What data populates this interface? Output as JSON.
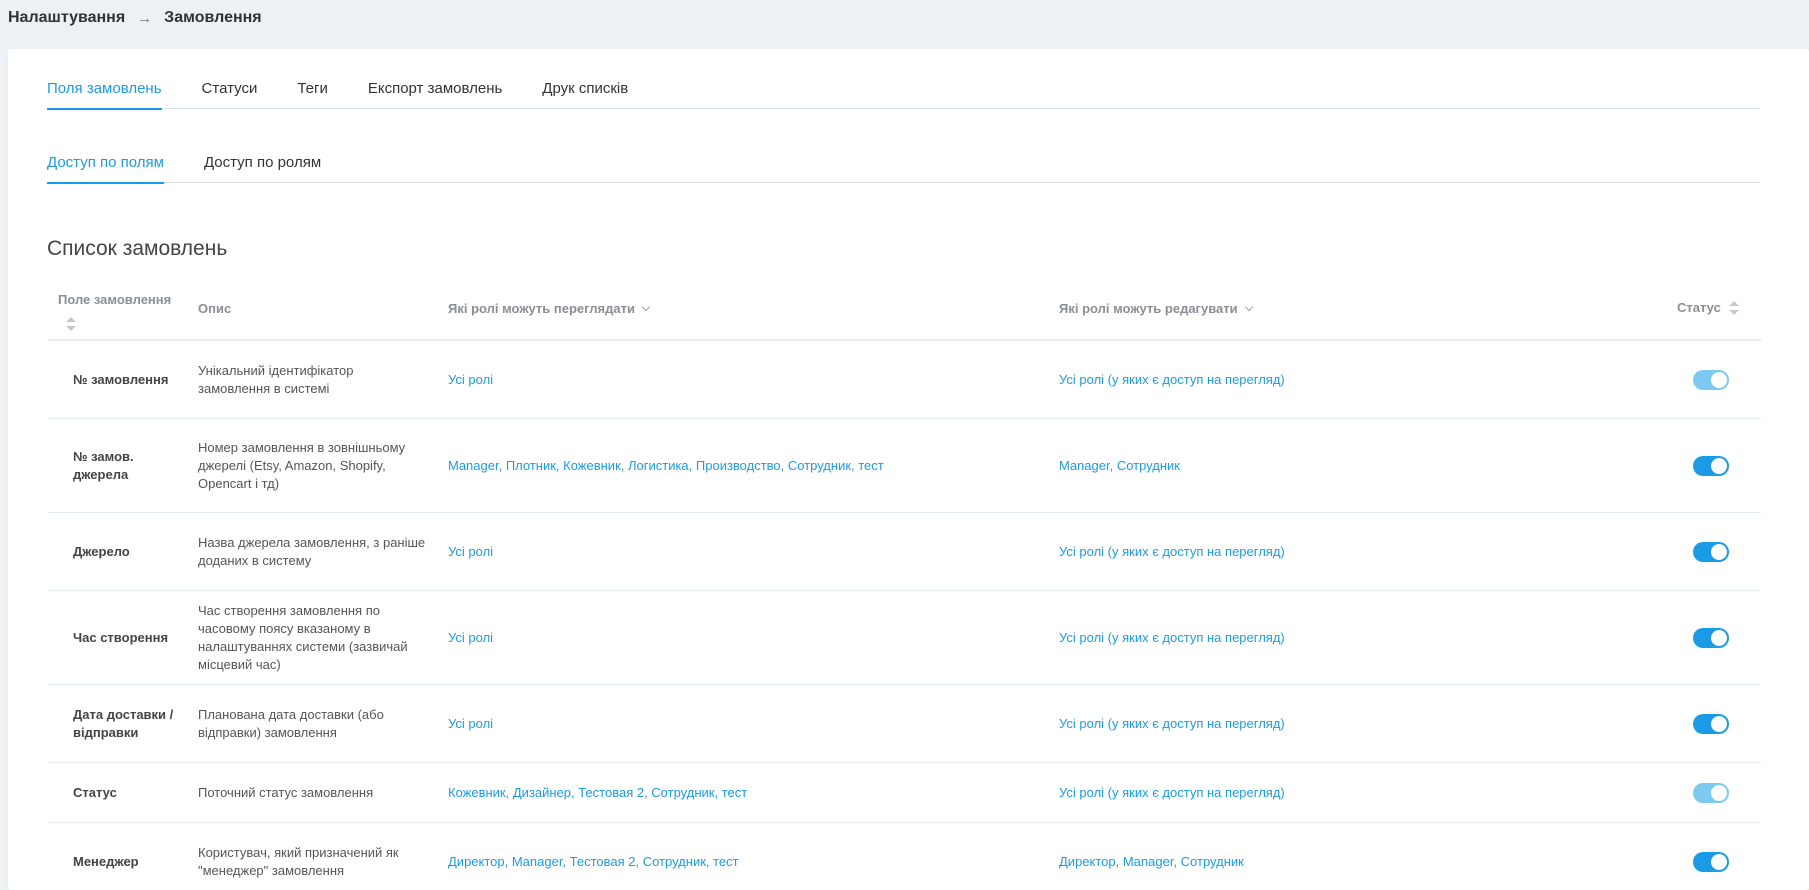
{
  "breadcrumb": {
    "parent": "Налаштування",
    "arrow": "→",
    "current": "Замовлення"
  },
  "tabs": [
    {
      "label": "Поля замовлень",
      "active": true
    },
    {
      "label": "Статуси",
      "active": false
    },
    {
      "label": "Теги",
      "active": false
    },
    {
      "label": "Експорт замовлень",
      "active": false
    },
    {
      "label": "Друк списків",
      "active": false
    }
  ],
  "subtabs": [
    {
      "label": "Доступ по полям",
      "active": true
    },
    {
      "label": "Доступ по ролям",
      "active": false
    }
  ],
  "section_title": "Список замовлень",
  "table": {
    "headers": {
      "field": "Поле замовлення",
      "description": "Опис",
      "view_roles": "Які ролі можуть переглядати",
      "edit_roles": "Які ролі можуть редагувати",
      "status": "Статус"
    },
    "rows": [
      {
        "field": "№ замовлення",
        "description": "Унікальний ідентифікатор замовлення в системі",
        "view": "Усі ролі",
        "edit": "Усі ролі (у яких є доступ на перегляд)",
        "enabled": true,
        "locked": true
      },
      {
        "field": "№ замов. джерела",
        "description": "Номер замовлення в зовнішньому джерелі (Etsy, Amazon, Shopify, Opencart і тд)",
        "view": "Manager, Плотник, Кожевник, Логистика, Производство, Сотрудник, тест",
        "edit": "Manager, Сотрудник",
        "enabled": true,
        "locked": false
      },
      {
        "field": "Джерело",
        "description": "Назва джерела замовлення, з раніше доданих в систему",
        "view": "Усі ролі",
        "edit": "Усі ролі (у яких є доступ на перегляд)",
        "enabled": true,
        "locked": false
      },
      {
        "field": "Час створення",
        "description": "Час створення замовлення по часовому поясу вказаному в налаштуваннях системи (зазвичай місцевий час)",
        "view": "Усі ролі",
        "edit": "Усі ролі (у яких є доступ на перегляд)",
        "enabled": true,
        "locked": false
      },
      {
        "field": "Дата доставки / відправки",
        "description": "Планована дата доставки (або відправки) замовлення",
        "view": "Усі ролі",
        "edit": "Усі ролі (у яких є доступ на перегляд)",
        "enabled": true,
        "locked": false
      },
      {
        "field": "Статус",
        "description": "Поточний статус замовлення",
        "view": "Кожевник, Дизайнер, Тестовая 2, Сотрудник, тест",
        "edit": "Усі ролі (у яких є доступ на перегляд)",
        "enabled": true,
        "locked": true
      },
      {
        "field": "Менеджер",
        "description": "Користувач, який призначений як \"менеджер\" замовлення",
        "view": "Директор, Manager, Тестовая 2, Сотрудник, тест",
        "edit": "Директор, Manager, Сотрудник",
        "enabled": true,
        "locked": false
      }
    ]
  },
  "colors": {
    "accent": "#1b9be6",
    "toggle_locked": "#7ccaf1",
    "background": "#eef1f4"
  }
}
